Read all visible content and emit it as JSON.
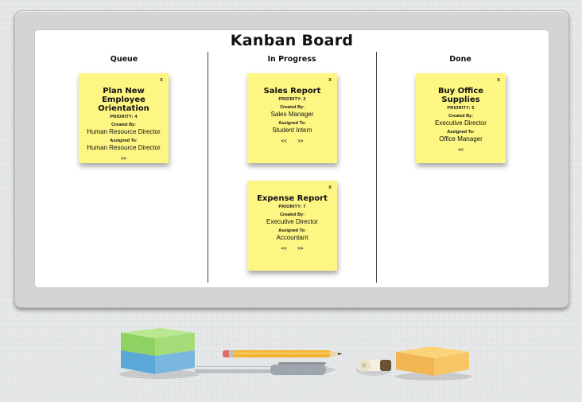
{
  "board": {
    "title": "Kanban Board"
  },
  "columns": [
    {
      "title": "Queue"
    },
    {
      "title": "In Progress"
    },
    {
      "title": "Done"
    }
  ],
  "labels": {
    "created_by": "Created By:",
    "assigned_to": "Assigned To:",
    "close": "x",
    "prev": "<<",
    "next": ">>"
  },
  "cards": [
    {
      "column": "Queue",
      "title": "Plan New Employee Orientation",
      "priority": "PRIORITY: 4",
      "created_by": "Human Resource Director",
      "assigned_to": "Human Resource Director",
      "actions": [
        ">>"
      ]
    },
    {
      "column": "In Progress",
      "title": "Sales Report",
      "priority": "PRIORITY: 2",
      "created_by": "Sales Manager",
      "assigned_to": "Student Intern",
      "actions": [
        "<<",
        ">>"
      ]
    },
    {
      "column": "In Progress",
      "title": "Expense Report",
      "priority": "PRIORITY: 7",
      "created_by": "Executive Director",
      "assigned_to": "Accountant",
      "actions": [
        "<<",
        ">>"
      ]
    },
    {
      "column": "Done",
      "title": "Buy Office Supplies",
      "priority": "PRIORITY: 5",
      "created_by": "Executive Director",
      "assigned_to": "Office Manager",
      "actions": [
        "<<"
      ]
    }
  ],
  "colors": {
    "note": "#fdf683",
    "frame": "#d4d4d4",
    "board": "#ffffff"
  }
}
